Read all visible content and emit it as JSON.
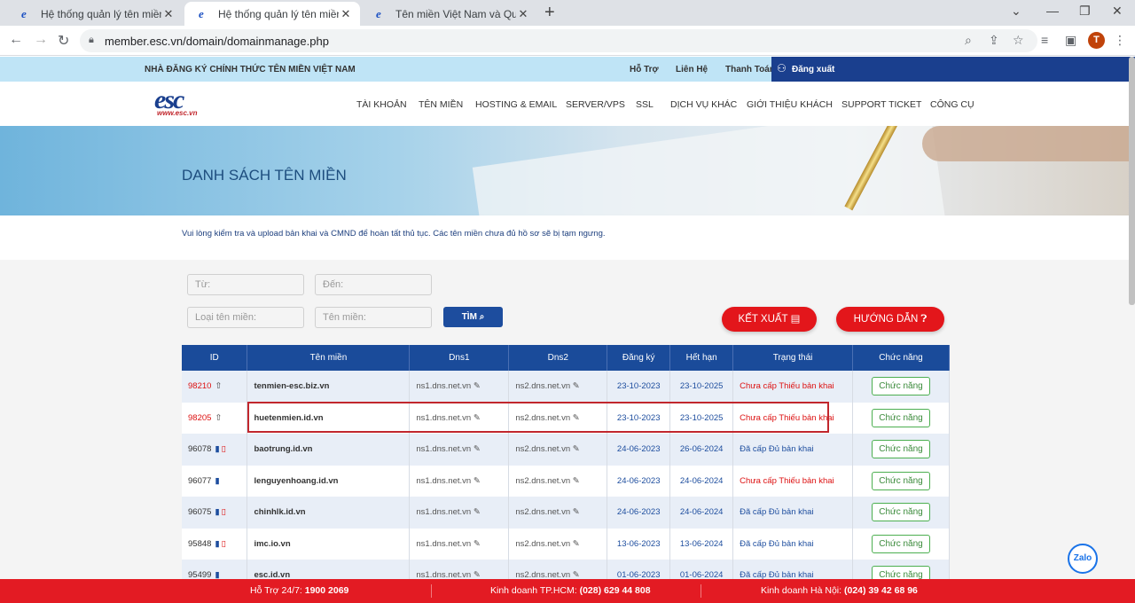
{
  "browser": {
    "tabs": [
      {
        "title": "Hệ thống quản lý tên miền, host"
      },
      {
        "title": "Hệ thống quản lý tên miền, host"
      },
      {
        "title": "Tên miền Việt Nam và Quốc tế"
      }
    ],
    "url": "member.esc.vn/domain/domainmanage.php",
    "avatar_letter": "T"
  },
  "topbar": {
    "tagline": "NHÀ ĐĂNG KÝ CHÍNH THỨC TÊN MIỀN VIỆT NAM",
    "support": "Hỗ Trợ",
    "contact": "Liên Hệ",
    "payment": "Thanh Toán",
    "logout": "Đăng xuất"
  },
  "logo": {
    "text": "esc",
    "url_text": "www.esc.vn"
  },
  "menu": [
    "TÀI KHOẢN",
    "TÊN MIỀN",
    "HOSTING & EMAIL",
    "SERVER/VPS",
    "SSL",
    "DỊCH VỤ KHÁC",
    "GIỚI THIỆU KHÁCH",
    "SUPPORT TICKET",
    "CÔNG CỤ"
  ],
  "banner": {
    "title": "DANH SÁCH TÊN MIỀN"
  },
  "notice": "Vui lòng kiểm tra và upload bản khai và CMND để hoàn tất thủ tục. Các tên miền chưa đủ hồ sơ sẽ bị tạm ngưng.",
  "filters": {
    "from_placeholder": "Từ:",
    "to_placeholder": "Đến:",
    "type_placeholder": "Loại tên miền:",
    "name_placeholder": "Tên miền:",
    "search_label": "TÌM",
    "export_label": "KẾT XUẤT",
    "guide_label": "HƯỚNG DẪN"
  },
  "table": {
    "headers": [
      "ID",
      "Tên miền",
      "Dns1",
      "Dns2",
      "Đăng ký",
      "Hết hạn",
      "Trạng thái",
      "Chức năng"
    ],
    "action_label": "Chức năng",
    "rows": [
      {
        "id": "98210",
        "domain": "tenmien-esc.biz.vn",
        "dns1": "ns1.dns.net.vn",
        "dns2": "ns2.dns.net.vn",
        "reg": "23-10-2023",
        "exp": "23-10-2025",
        "status": "Chưa cấp Thiếu bản khai",
        "status_type": "red",
        "id_type": "red",
        "id_icon": "upload"
      },
      {
        "id": "98205",
        "domain": "huetenmien.id.vn",
        "dns1": "ns1.dns.net.vn",
        "dns2": "ns2.dns.net.vn",
        "reg": "23-10-2023",
        "exp": "23-10-2025",
        "status": "Chưa cấp Thiếu bản khai",
        "status_type": "red",
        "id_type": "red",
        "id_icon": "upload"
      },
      {
        "id": "96078",
        "domain": "baotrung.id.vn",
        "dns1": "ns1.dns.net.vn",
        "dns2": "ns2.dns.net.vn",
        "reg": "24-06-2023",
        "exp": "26-06-2024",
        "status": "Đã cấp Đủ bản khai",
        "status_type": "blue",
        "id_type": "normal",
        "id_icon": "doc-pdf"
      },
      {
        "id": "96077",
        "domain": "lenguyenhoang.id.vn",
        "dns1": "ns1.dns.net.vn",
        "dns2": "ns2.dns.net.vn",
        "reg": "24-06-2023",
        "exp": "24-06-2024",
        "status": "Chưa cấp Thiếu bản khai",
        "status_type": "red",
        "id_type": "normal",
        "id_icon": "doc"
      },
      {
        "id": "96075",
        "domain": "chinhlk.id.vn",
        "dns1": "ns1.dns.net.vn",
        "dns2": "ns2.dns.net.vn",
        "reg": "24-06-2023",
        "exp": "24-06-2024",
        "status": "Đã cấp Đủ bản khai",
        "status_type": "blue",
        "id_type": "normal",
        "id_icon": "doc-pdf"
      },
      {
        "id": "95848",
        "domain": "imc.io.vn",
        "dns1": "ns1.dns.net.vn",
        "dns2": "ns2.dns.net.vn",
        "reg": "13-06-2023",
        "exp": "13-06-2024",
        "status": "Đã cấp Đủ bản khai",
        "status_type": "blue",
        "id_type": "normal",
        "id_icon": "doc-pdf"
      },
      {
        "id": "95499",
        "domain": "esc.id.vn",
        "dns1": "ns1.dns.net.vn",
        "dns2": "ns2.dns.net.vn",
        "reg": "01-06-2023",
        "exp": "01-06-2024",
        "status": "Đã cấp Đủ bản khai",
        "status_type": "blue",
        "id_type": "normal",
        "id_icon": "doc"
      }
    ]
  },
  "footer": {
    "support_label": "Hỗ Trợ 24/7:",
    "support_number": "1900 2069",
    "hcm_label": "Kinh doanh TP.HCM:",
    "hcm_number": "(028) 629 44 808",
    "hn_label": "Kinh doanh Hà Nội:",
    "hn_number": "(024) 39 42 68 96"
  },
  "zalo": "Zalo",
  "colors": {
    "brand_blue": "#1a4b9a",
    "accent_red": "#e31b23",
    "highlight": "#c1272d"
  }
}
